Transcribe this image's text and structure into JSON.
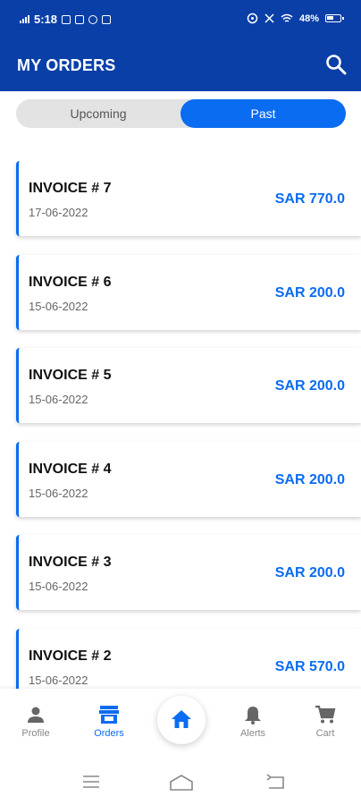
{
  "status_bar": {
    "time": "5:18",
    "battery": "48%"
  },
  "app_bar": {
    "title": "MY ORDERS",
    "search_icon": "search-icon"
  },
  "segment": {
    "options": [
      "Upcoming",
      "Past"
    ],
    "selected": "Past"
  },
  "orders": [
    {
      "title": "INVOICE # 7",
      "date": "17-06-2022",
      "amount": "SAR 770.0"
    },
    {
      "title": "INVOICE # 6",
      "date": "15-06-2022",
      "amount": "SAR 200.0"
    },
    {
      "title": "INVOICE # 5",
      "date": "15-06-2022",
      "amount": "SAR 200.0"
    },
    {
      "title": "INVOICE # 4",
      "date": "15-06-2022",
      "amount": "SAR 200.0"
    },
    {
      "title": "INVOICE # 3",
      "date": "15-06-2022",
      "amount": "SAR 200.0"
    },
    {
      "title": "INVOICE # 2",
      "date": "15-06-2022",
      "amount": "SAR 570.0"
    }
  ],
  "bottom_nav": {
    "items": [
      {
        "label": "Profile",
        "icon": "person-icon"
      },
      {
        "label": "Orders",
        "icon": "store-icon"
      },
      {
        "label": "",
        "icon": "home-icon"
      },
      {
        "label": "Alerts",
        "icon": "bell-icon"
      },
      {
        "label": "Cart",
        "icon": "cart-icon"
      }
    ],
    "active": "Orders"
  },
  "colors": {
    "primary_dark": "#0a3fa8",
    "accent": "#0a6cf1",
    "segment_bg": "#e3e3e3",
    "muted": "#888888"
  }
}
